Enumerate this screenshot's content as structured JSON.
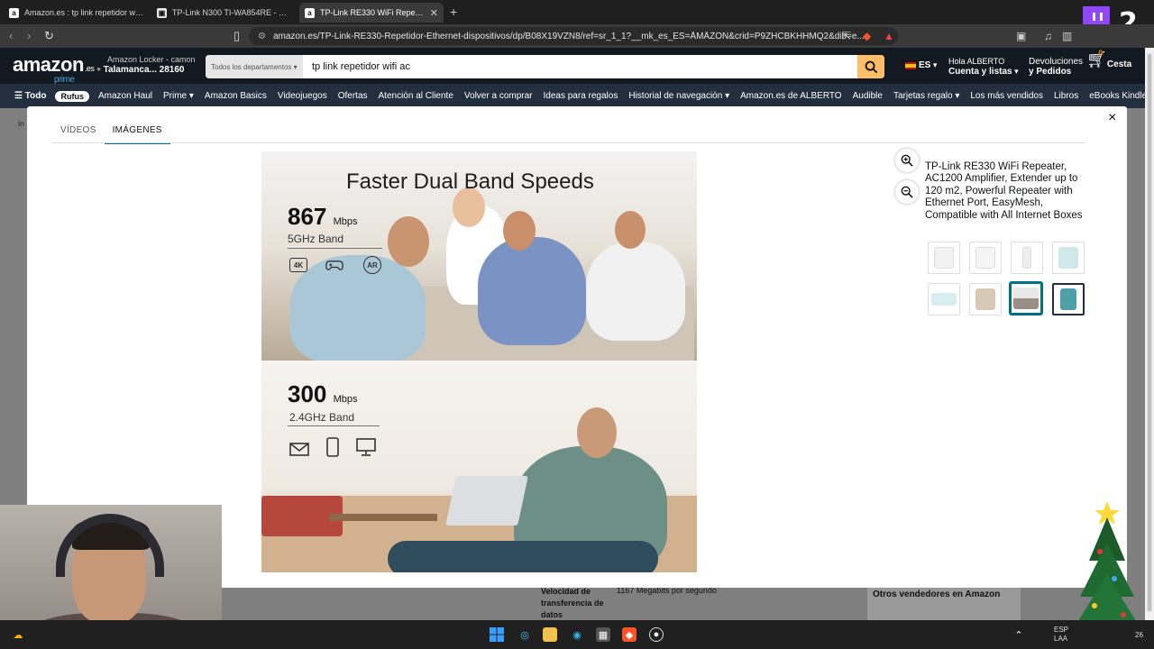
{
  "browser": {
    "tabs": [
      {
        "label": "Amazon.es : tp link repetidor wifi ac",
        "favicon": "amazon-icon",
        "active": false
      },
      {
        "label": "TP-Link N300 TI-WA854RE - Repetido",
        "favicon": "tplink-icon",
        "active": false
      },
      {
        "label": "TP-Link RE330 WiFi Repeater, AC",
        "favicon": "amazon-icon",
        "active": true
      }
    ],
    "url": "amazon.es/TP-Link-RE330-Repetidor-Ethernet-dispositivos/dp/B08X19VZN8/ref=sr_1_1?__mk_es_ES=ÅMÅŽÕÑ&crid=P9ZHCBKHHMQ2&dib=e..."
  },
  "amazon": {
    "logo_text": "amazon",
    "logo_suffix": ".es",
    "logo_prime": "prime",
    "locker_line1": "Amazon Locker - camon",
    "locker_line2": "Talamanca... 28160",
    "search_department": "Todos los departamentos",
    "search_query": "tp link repetidor wifi ac",
    "language": "ES",
    "account_greeting": "Hola ALBERTO",
    "account_label": "Cuenta y listas",
    "returns_line1": "Devoluciones",
    "returns_line2": "y Pedidos",
    "cart_count": "0",
    "cart_label": "Cesta",
    "nav_items": [
      "Todo",
      "Rufus",
      "Amazon Haul",
      "Prime",
      "Amazon Basics",
      "Videojuegos",
      "Ofertas",
      "Atención al Cliente",
      "Volver a comprar",
      "Ideas para regalos",
      "Historial de navegación",
      "Amazon.es de ALBERTO",
      "Audible",
      "Tarjetas regalo",
      "Los más vendidos",
      "Libros",
      "eBooks Kindle"
    ]
  },
  "background_page": {
    "spec_label": "Velocidad de transferencia de datos",
    "spec_value": "1167 Megabits por segundo",
    "sellers_label": "Otros vendedores en Amazon",
    "left_fragment": "In"
  },
  "modal": {
    "tabs": [
      "VÍDEOS",
      "IMÁGENES"
    ],
    "active_tab": "IMÁGENES",
    "close_glyph": "×",
    "product_title": "TP-Link RE330 WiFi Repeater, AC1200 Amplifier, Extender up to 120 m2, Powerful Repeater with Ethernet Port, EasyMesh, Compatible with All Internet Boxes",
    "image": {
      "headline": "Faster Dual Band Speeds",
      "band1_speed": "867",
      "band1_unit": "Mbps",
      "band1_label": "5GHz Band",
      "band1_icons": [
        "4K",
        "gamepad-icon",
        "AR"
      ],
      "band2_speed": "300",
      "band2_unit": "Mbps",
      "band2_label": "2.4GHz Band",
      "band2_icons": [
        "mail-icon",
        "phone-icon",
        "monitor-icon"
      ]
    },
    "thumbnails": [
      {
        "name": "thumb-1",
        "color": "#f2f2f2",
        "selected": false
      },
      {
        "name": "thumb-2",
        "color": "#f5f5f5",
        "selected": false
      },
      {
        "name": "thumb-3",
        "color": "#eeeeee",
        "selected": false
      },
      {
        "name": "thumb-4",
        "color": "#cfe8ea",
        "selected": false
      },
      {
        "name": "thumb-5",
        "color": "#d6eef0",
        "selected": false
      },
      {
        "name": "thumb-6",
        "color": "#d8c9b6",
        "selected": false
      },
      {
        "name": "thumb-7",
        "color": "#9a8f86",
        "selected": true
      },
      {
        "name": "thumb-8",
        "color": "#4e9fa8",
        "selected": false
      }
    ]
  },
  "taskbar": {
    "language": "ESP",
    "language_sub": "LAA",
    "time_fragment": "26"
  },
  "overlay": {
    "channel_badge": "2"
  }
}
